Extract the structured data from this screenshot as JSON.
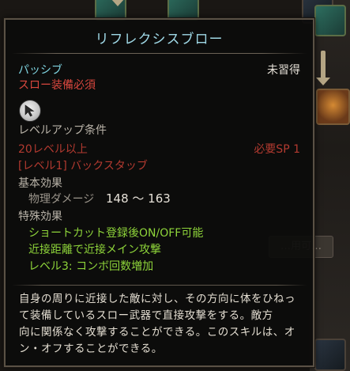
{
  "tooltip": {
    "title": "リフレクシスブロー",
    "type": "パッシブ",
    "status": "未習得",
    "requirement_weapon": "スロー装備必須",
    "levelup_header": "レベルアップ条件",
    "level_req": "20レベル以上",
    "sp_req": "必要SP 1",
    "prereq_skill": "[レベル1] バックスタッブ",
    "basic_effect_header": "基本効果",
    "phys_damage_label": "物理ダメージ",
    "phys_damage_value": "148 ～ 163",
    "special_effect_header": "特殊効果",
    "special_effects": [
      "ショートカット登録後ON/OFF可能",
      "近接距離で近接メイン攻撃",
      "レベル3: コンボ回数増加"
    ],
    "description_lines": [
      "自身の周りに近接した敵に対し、その方向に体をひねっ",
      "て装備しているスロー武器で直接攻撃をする。敵方",
      "向に関係なく攻撃することができる。このスキルは、オ",
      "ン・オフすることができる。"
    ],
    "icon": "arrow-cursor-icon"
  },
  "background": {
    "button_label": "…用可…"
  },
  "colors": {
    "title": "#9fd8e6",
    "passive": "#7fd4e0",
    "requirement": "#d9473e",
    "special": "#8ed43a"
  }
}
